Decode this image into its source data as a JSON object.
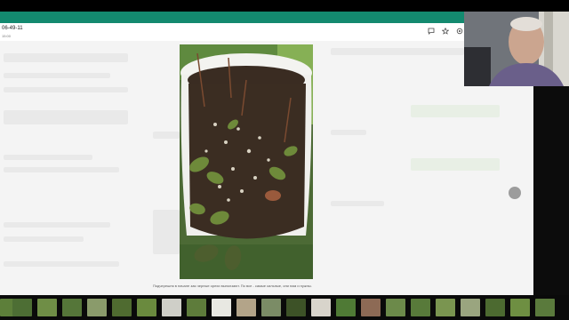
{
  "header": {
    "title": "06-49-11",
    "subtitle": "15:00"
  },
  "caption": "Подчерешня в начале зая черные орехи выползают. По все - самые сильные, они нам и нужны.",
  "icons": [
    "comment-icon",
    "star-icon",
    "settings-icon"
  ],
  "colors": {
    "green_bar": "#138a6f",
    "page_bg": "#f4f4f4"
  }
}
